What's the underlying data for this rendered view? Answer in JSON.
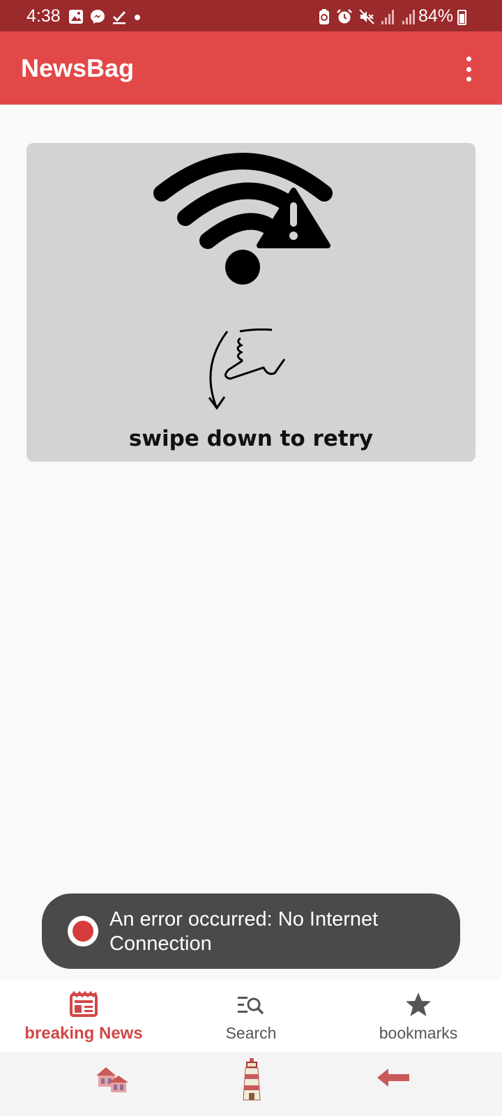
{
  "status_bar": {
    "time": "4:38",
    "battery": "84%",
    "left_icons": [
      "gallery-icon",
      "messenger-icon",
      "check-icon",
      "dot-icon"
    ],
    "right_icons": [
      "battery-saver-icon",
      "alarm-icon",
      "mute-icon",
      "signal-icon",
      "signal-icon"
    ]
  },
  "app_bar": {
    "title": "NewsBag",
    "menu_icon": "more-vert-icon"
  },
  "error_card": {
    "message": "swipe down to retry",
    "illustration": "no-wifi-warning-icon",
    "gesture": "swipe-down-hand-icon"
  },
  "toast": {
    "text": "An error occurred: No Internet Connection"
  },
  "bottom_nav": {
    "items": [
      {
        "label": "breaking News",
        "icon": "newspaper-icon",
        "active": true
      },
      {
        "label": "Search",
        "icon": "search-list-icon",
        "active": false
      },
      {
        "label": "bookmarks",
        "icon": "star-icon",
        "active": false
      }
    ]
  },
  "system_nav": {
    "buttons": [
      "recents-icon",
      "home-icon",
      "back-icon"
    ]
  },
  "colors": {
    "status_bar": "#9a2a2c",
    "app_bar": "#e34848",
    "accent": "#d14747",
    "card": "#d3d3d3",
    "toast": "#4a4a4a"
  }
}
